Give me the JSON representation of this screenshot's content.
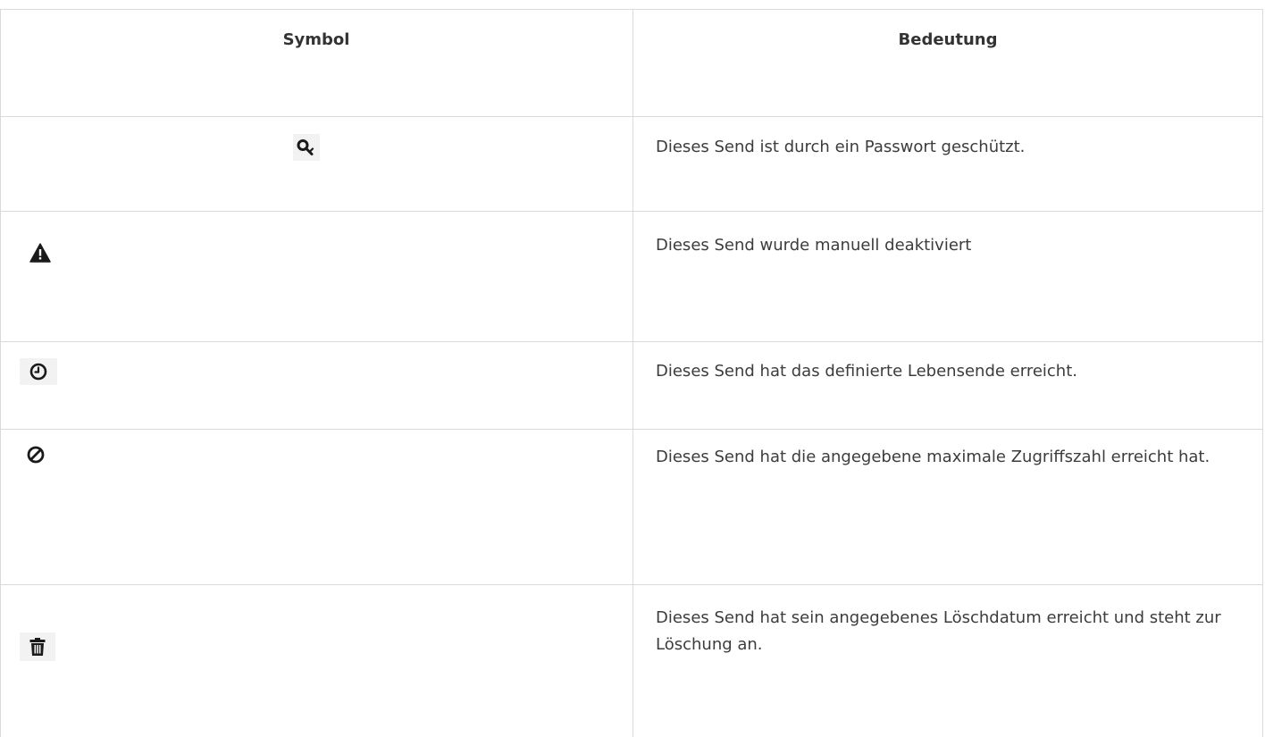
{
  "table": {
    "headers": {
      "symbol": "Symbol",
      "meaning": "Bedeutung"
    },
    "rows": [
      {
        "icon": "key-icon",
        "text": "Dieses Send ist durch ein Passwort geschützt."
      },
      {
        "icon": "warning-icon",
        "text": "Dieses Send wurde manuell deaktiviert"
      },
      {
        "icon": "clock-icon",
        "text": "Dieses Send hat das definierte Lebensende erreicht."
      },
      {
        "icon": "ban-icon",
        "text": "Dieses Send hat die angegebene maximale Zugriffszahl erreicht hat."
      },
      {
        "icon": "trash-icon",
        "text": "Dieses Send hat sein angegebenes Löschdatum erreicht und steht zur Löschung an."
      }
    ]
  },
  "colors": {
    "border": "#d9d9d9",
    "text": "#3c3c3c",
    "icon": "#1a1a1a"
  }
}
